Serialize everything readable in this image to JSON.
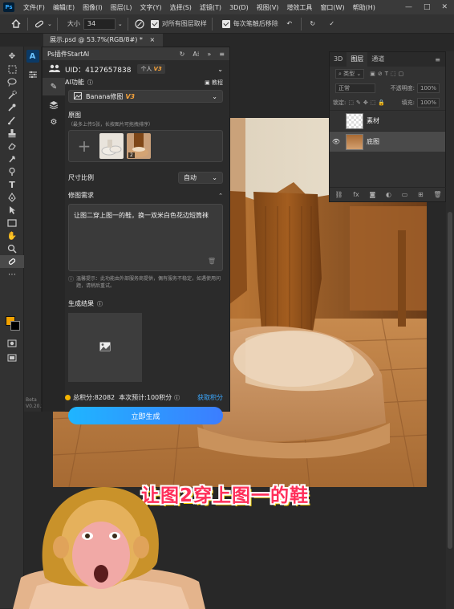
{
  "menubar": {
    "app_icon": "Ps",
    "items": [
      "文件(F)",
      "编辑(E)",
      "图像(I)",
      "图层(L)",
      "文字(Y)",
      "选择(S)",
      "滤镜(T)",
      "3D(D)",
      "视图(V)",
      "增效工具",
      "窗口(W)",
      "帮助(H)"
    ],
    "window_controls": [
      "minimize-icon",
      "maximize-icon",
      "close-icon"
    ]
  },
  "options_bar": {
    "size_label": "大小",
    "size_value": "34",
    "sample_all_layers": "对所有图层取样",
    "remove_after_stroke": "每次笔触后移除"
  },
  "document_tab": {
    "title": "展示.psd @ 53.7%(RGB/8#) *",
    "close": "×"
  },
  "plugin": {
    "title": "Ps插件StartAI",
    "user_label": "UID：4127657838",
    "user_badge": "个人",
    "user_version": "V3",
    "ai_function_label": "AI功能",
    "tutorial_label": "教程",
    "model_name": "Banana修图",
    "model_version": "V3",
    "original_label": "原图",
    "original_hint": "（最多上传5张，长按图片可拖拽排序）",
    "thumb_number": "2",
    "ratio_label": "尺寸比例",
    "ratio_value": "自动",
    "requirement_label": "修图需求",
    "requirement_text": "让图二穿上图一的鞋，换一双米白色花边短筒袜",
    "notice_text": "温馨提示：此功能由外部服务商提供，偶有服务不稳定，如遇使用问题，请稍后重试。",
    "result_label": "生成结果",
    "total_points": "总积分:82082",
    "estimate": "本次预计:100积分",
    "get_points": "获取积分",
    "generate_button": "立即生成",
    "beta_label": "Beta",
    "version_label": "V0.20.x"
  },
  "layers": {
    "tabs": [
      "3D",
      "图层",
      "通道"
    ],
    "active_tab": "图层",
    "filter_label": "类型",
    "blend_mode": "正常",
    "opacity_label": "不透明度:",
    "opacity_value": "100%",
    "lock_label": "锁定:",
    "fill_label": "填充:",
    "fill_value": "100%",
    "items": [
      {
        "name": "素材",
        "visible": false
      },
      {
        "name": "底图",
        "visible": true
      }
    ]
  },
  "caption": "让图2穿上图一的鞋",
  "colors": {
    "accent": "#1fb5ff",
    "foreground": "#f1a200",
    "background": "#000000",
    "caption": "#ff2f5a",
    "v3": "#f4a23c"
  }
}
